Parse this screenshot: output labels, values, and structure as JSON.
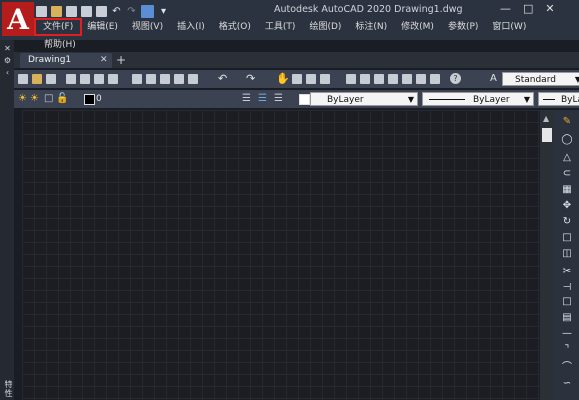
{
  "app": {
    "logo_letter": "A",
    "window_title": "Autodesk AutoCAD 2020    Drawing1.dwg",
    "window_controls": [
      "—",
      "□",
      "✕"
    ]
  },
  "quick_access": {
    "icons": [
      "new-icon",
      "open-icon",
      "save-icon",
      "saveas-icon",
      "print-icon",
      "undo-icon",
      "redo-icon",
      "workspace-icon"
    ]
  },
  "menu": {
    "items": [
      "文件(F)",
      "编辑(E)",
      "视图(V)",
      "插入(I)",
      "格式(O)",
      "工具(T)",
      "绘图(D)",
      "标注(N)",
      "修改(M)",
      "参数(P)",
      "窗口(W)"
    ],
    "second_row": "帮助(H)",
    "highlight_color": "#e02020"
  },
  "tabs": {
    "active_tab": "Drawing1",
    "close_glyph": "✕",
    "add_glyph": "+"
  },
  "toolbar_standard": {
    "text_icon": "A",
    "text_style": "Standard"
  },
  "toolbar_layers": {
    "layer_name": "0",
    "color_value": "ByLayer",
    "linetype_value": "ByLayer",
    "lineweight_value": "ByLa"
  },
  "properties_palette": {
    "label": "特性"
  },
  "colors": {
    "brand": "#b51d1d",
    "titlebar": "#2c3340",
    "canvas": "#1b1d22",
    "toolbar": "#3b4352"
  }
}
